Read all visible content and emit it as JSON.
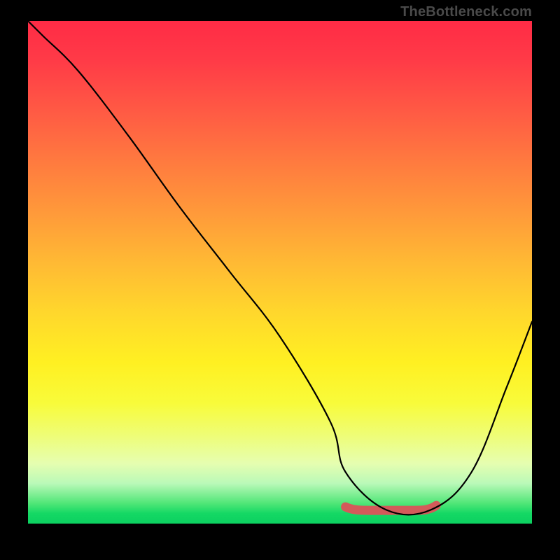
{
  "watermark": "TheBottleneck.com",
  "chart_data": {
    "type": "line",
    "title": "",
    "xlabel": "",
    "ylabel": "",
    "xlim": [
      0,
      100
    ],
    "ylim": [
      0,
      100
    ],
    "grid": false,
    "series": [
      {
        "name": "black-curve",
        "x": [
          0,
          3,
          10,
          20,
          30,
          40,
          50,
          60,
          63,
          71,
          80,
          88,
          95,
          100
        ],
        "values": [
          100,
          97,
          90,
          77,
          63,
          50,
          37,
          20,
          10,
          2.5,
          2.5,
          10,
          27,
          40
        ]
      }
    ],
    "highlight": {
      "name": "optimal-region",
      "color": "#d35a5a",
      "x_range": [
        63,
        81
      ],
      "y": 2.5
    }
  }
}
